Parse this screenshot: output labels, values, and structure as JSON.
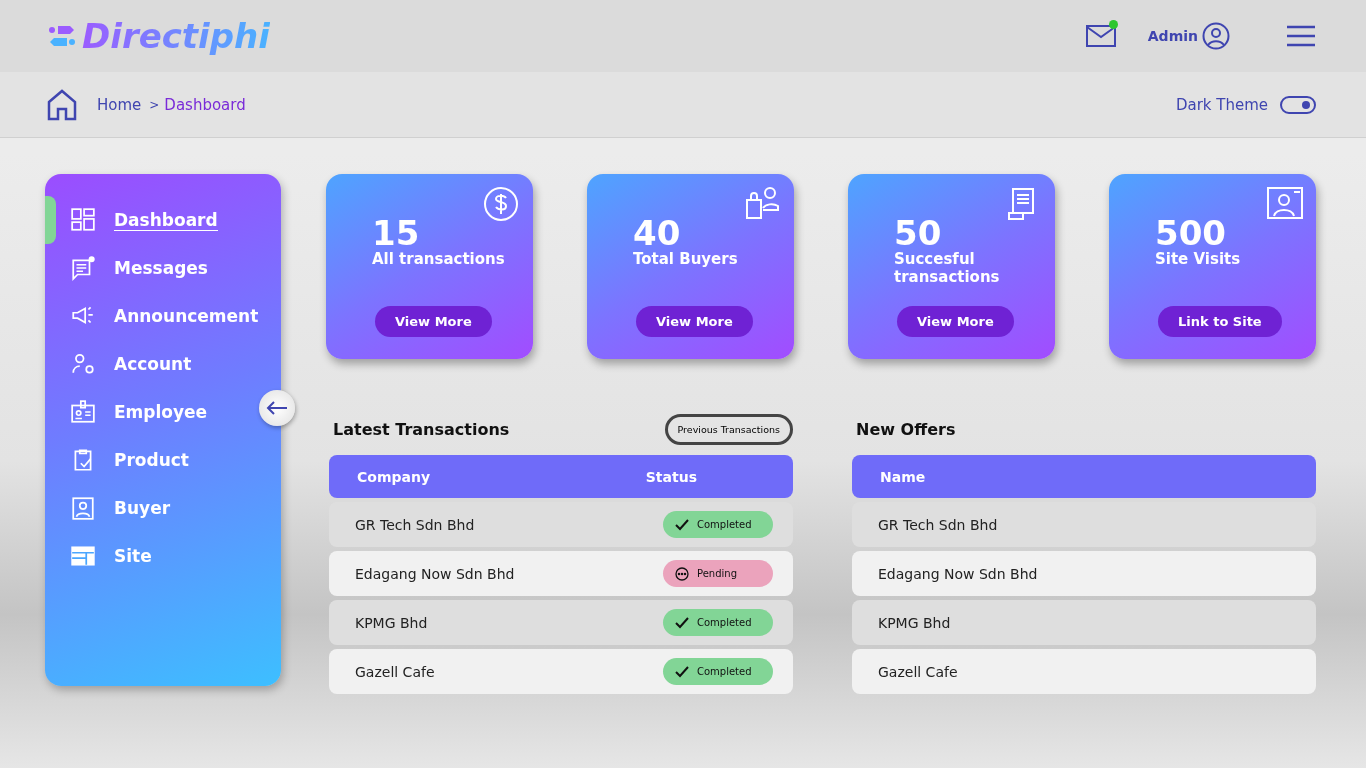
{
  "header": {
    "logo": "Directiphi",
    "mail_notification": true,
    "user": "Admin"
  },
  "breadcrumb": {
    "items": [
      {
        "label": "Home",
        "selected": false
      },
      {
        "label": "Dashboard",
        "selected": true
      }
    ],
    "separator": ">"
  },
  "theme_toggle": {
    "label": "Dark Theme",
    "on": true
  },
  "sidebar": {
    "items": [
      {
        "label": "Dashboard",
        "selected": true
      },
      {
        "label": "Messages",
        "selected": false
      },
      {
        "label": "Announcement",
        "selected": false
      },
      {
        "label": "Account",
        "selected": false
      },
      {
        "label": "Employee",
        "selected": false
      },
      {
        "label": "Product",
        "selected": false
      },
      {
        "label": "Buyer",
        "selected": false
      },
      {
        "label": "Site",
        "selected": false
      }
    ]
  },
  "stats": [
    {
      "value": "15",
      "label": "All transactions",
      "button": "View More"
    },
    {
      "value": "40",
      "label": "Total Buyers",
      "button": "View More"
    },
    {
      "value": "50",
      "label": "Succesful transactions",
      "button": "View More"
    },
    {
      "value": "500",
      "label": "Site Visits",
      "button": "Link to Site"
    }
  ],
  "latest_transactions": {
    "title": "Latest Transactions",
    "button": "Previous Transactions",
    "columns": [
      "Company",
      "Status"
    ],
    "rows": [
      {
        "company": "GR Tech Sdn Bhd",
        "status": {
          "kind": "completed",
          "label": "Completed",
          "color": "#82d596"
        }
      },
      {
        "company": "Edagang Now Sdn Bhd",
        "status": {
          "kind": "pending",
          "label": "Pending",
          "color": "#eba3bc"
        }
      },
      {
        "company": "KPMG Bhd",
        "status": {
          "kind": "completed",
          "label": "Completed",
          "color": "#82d596"
        }
      },
      {
        "company": "Gazell Cafe",
        "status": {
          "kind": "completed",
          "label": "Completed",
          "color": "#82d596"
        }
      }
    ]
  },
  "new_offers": {
    "title": "New Offers",
    "columns": [
      "Name"
    ],
    "rows": [
      "GR Tech Sdn Bhd",
      "Edagang Now Sdn Bhd",
      "KPMG Bhd",
      "Gazell Cafe"
    ]
  }
}
